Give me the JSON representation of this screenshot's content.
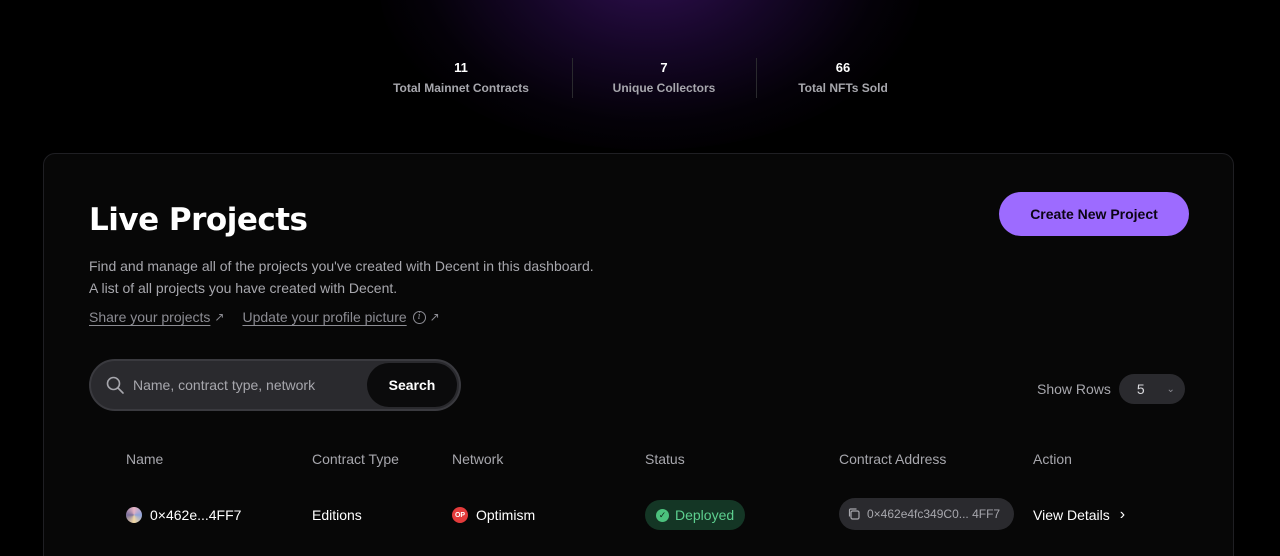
{
  "stats": [
    {
      "value": "11",
      "label": "Total Mainnet Contracts"
    },
    {
      "value": "7",
      "label": "Unique Collectors"
    },
    {
      "value": "66",
      "label": "Total NFTs Sold"
    }
  ],
  "projects": {
    "title": "Live Projects",
    "create_button": "Create New Project",
    "description_1": "Find and manage all of the projects you've created with Decent in this dashboard.",
    "description_2": "A list of all projects you have created with Decent.",
    "link_share": "Share your projects",
    "link_update": "Update your profile picture",
    "search_placeholder": "Name, contract type, network",
    "search_button": "Search",
    "show_rows_label": "Show Rows",
    "show_rows_value": "5"
  },
  "table": {
    "columns": [
      "Name",
      "Contract Type",
      "Network",
      "Status",
      "Contract Address",
      "Action"
    ],
    "rows": [
      {
        "name": "0×462e...4FF7",
        "contract_type": "Editions",
        "network": "Optimism",
        "network_icon": "OP",
        "status": "Deployed",
        "address": "0×462e4fc349C0... 4FF7",
        "action": "View Details"
      }
    ]
  },
  "colors": {
    "accent": "#9d6bff",
    "status_green": "#5dcf8f",
    "optimism_red": "#e33b3b"
  }
}
